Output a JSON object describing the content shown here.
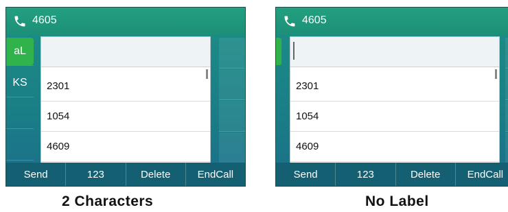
{
  "colors": {
    "title_green": "#23a07f",
    "active_key": "#2fb34a",
    "softkey_bar": "#155f73"
  },
  "screens": [
    {
      "title_number": "4605",
      "line_keys": [
        "aL",
        "KS"
      ],
      "list_items": [
        "2301",
        "1054",
        "4609"
      ],
      "softkeys": [
        "Send",
        "123",
        "Delete",
        "EndCall"
      ],
      "caption": "2 Characters"
    },
    {
      "title_number": "4605",
      "line_keys": [],
      "list_items": [
        "2301",
        "1054",
        "4609"
      ],
      "softkeys": [
        "Send",
        "123",
        "Delete",
        "EndCall"
      ],
      "caption": "No Label"
    }
  ]
}
